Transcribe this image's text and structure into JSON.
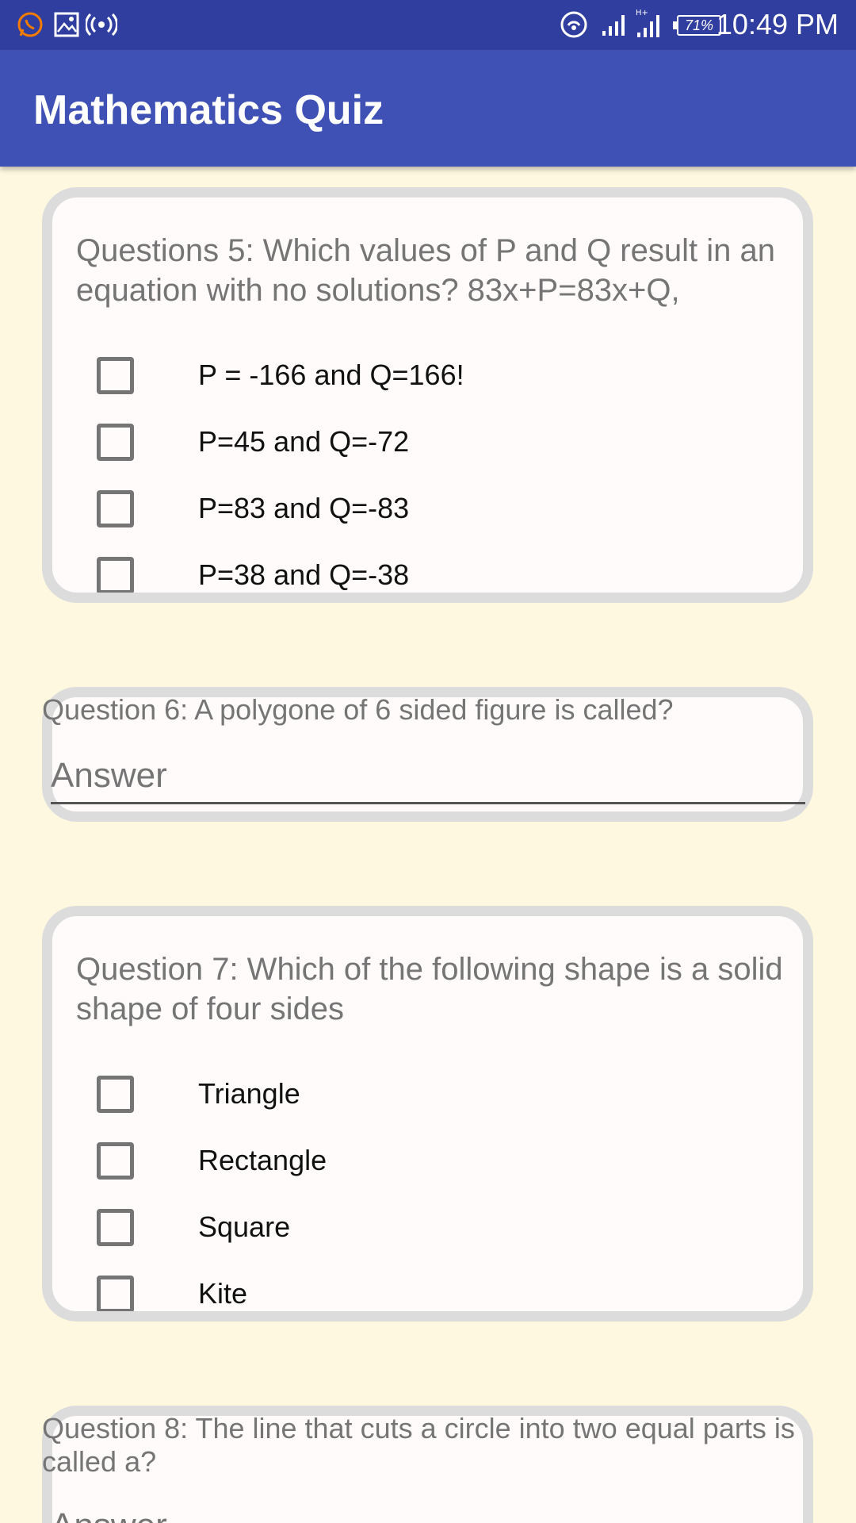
{
  "status_bar": {
    "time": "10:49 PM",
    "battery": "71%",
    "icons": [
      "whatsapp-icon",
      "image-icon",
      "hotspot-icon",
      "wifi-icon",
      "signal-icon",
      "signal-4g-icon"
    ]
  },
  "app_bar": {
    "title": "Mathematics Quiz"
  },
  "questions": [
    {
      "text": "Questions 5: Which values of P and Q result in an equation with no solutions? 83x+P=83x+Q,",
      "options": [
        "P = -166 and Q=166!",
        "P=45 and Q=-72",
        "P=83 and Q=-83",
        "P=38 and Q=-38"
      ]
    },
    {
      "text": "Question 6: A polygone of 6 sided figure is called?",
      "placeholder": "Answer"
    },
    {
      "text": "Question 7: Which of the following shape is a solid shape of four sides",
      "options": [
        "Triangle",
        "Rectangle",
        "Square",
        "Kite"
      ]
    },
    {
      "text": "Question 8: The line that cuts a circle into two equal parts is called a?",
      "placeholder": "Answer"
    }
  ],
  "colors": {
    "status_bar": "#303F9F",
    "app_bar": "#3F51B5",
    "background": "#FFF8E1",
    "card_border": "#DCDCDC"
  }
}
